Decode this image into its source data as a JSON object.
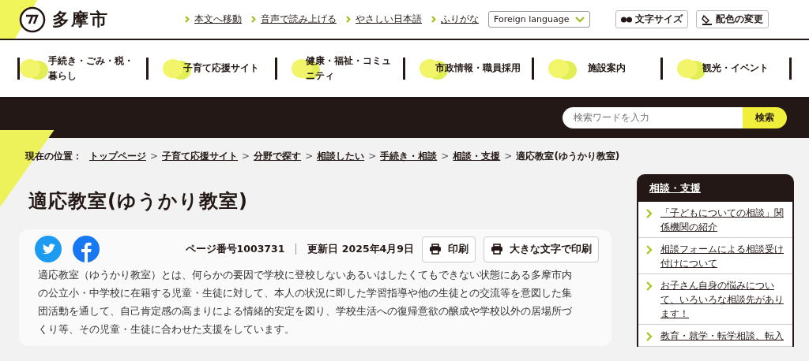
{
  "header": {
    "logo_text": "多摩市",
    "links": [
      "本文へ移動",
      "音声で読み上げる",
      "やさしい日本語",
      "ふりがな"
    ],
    "language_select": "Foreign language",
    "text_size_button": "文字サイズ",
    "color_button": "配色の変更"
  },
  "nav": [
    "手続き・ごみ・税・暮らし",
    "子育て応援サイト",
    "健康・福祉・コミュニティ",
    "市政情報・職員採用",
    "施設案内",
    "観光・イベント"
  ],
  "search": {
    "placeholder": "検索ワードを入力",
    "button": "検索"
  },
  "breadcrumb": {
    "label": "現在の位置：",
    "links": [
      "トップページ",
      "子育て応援サイト",
      "分野で探す",
      "相談したい",
      "手続き・相談",
      "相談・支援"
    ],
    "separators": [
      ">",
      ">",
      ">",
      ">",
      ">",
      ">"
    ],
    "current": "適応教室(ゆうかり教室)"
  },
  "page_title": "適応教室(ゆうかり教室)",
  "meta": {
    "page_number": "ページ番号1003731",
    "updated": "更新日 2025年4月9日",
    "print_button": "印刷",
    "large_print_button": "大きな文字で印刷"
  },
  "body_text": "適応教室（ゆうかり教室）とは、何らかの要因で学校に登校しないあるいはしたくてもできない状態にある多摩市内の公立小・中学校に在籍する児童・生徒に対して、本人の状況に即した学習指導や他の生徒との交流等を意図した集団活動を通して、自己肯定感の高まりによる情緒的安定を図り、学校生活への復帰意欲の醸成や学校以外の居場所づくり等、その児童・生徒に合わせた支援をしています。",
  "sidebar": {
    "title": "相談・支援",
    "items": [
      "「子どもについての相談」関係機関の紹介",
      "相談フォームによる相談受け付けについて",
      "お子さん自身の悩みについて、いろいろな相談先があります！",
      "教育・就学・転学相談、転入"
    ]
  }
}
